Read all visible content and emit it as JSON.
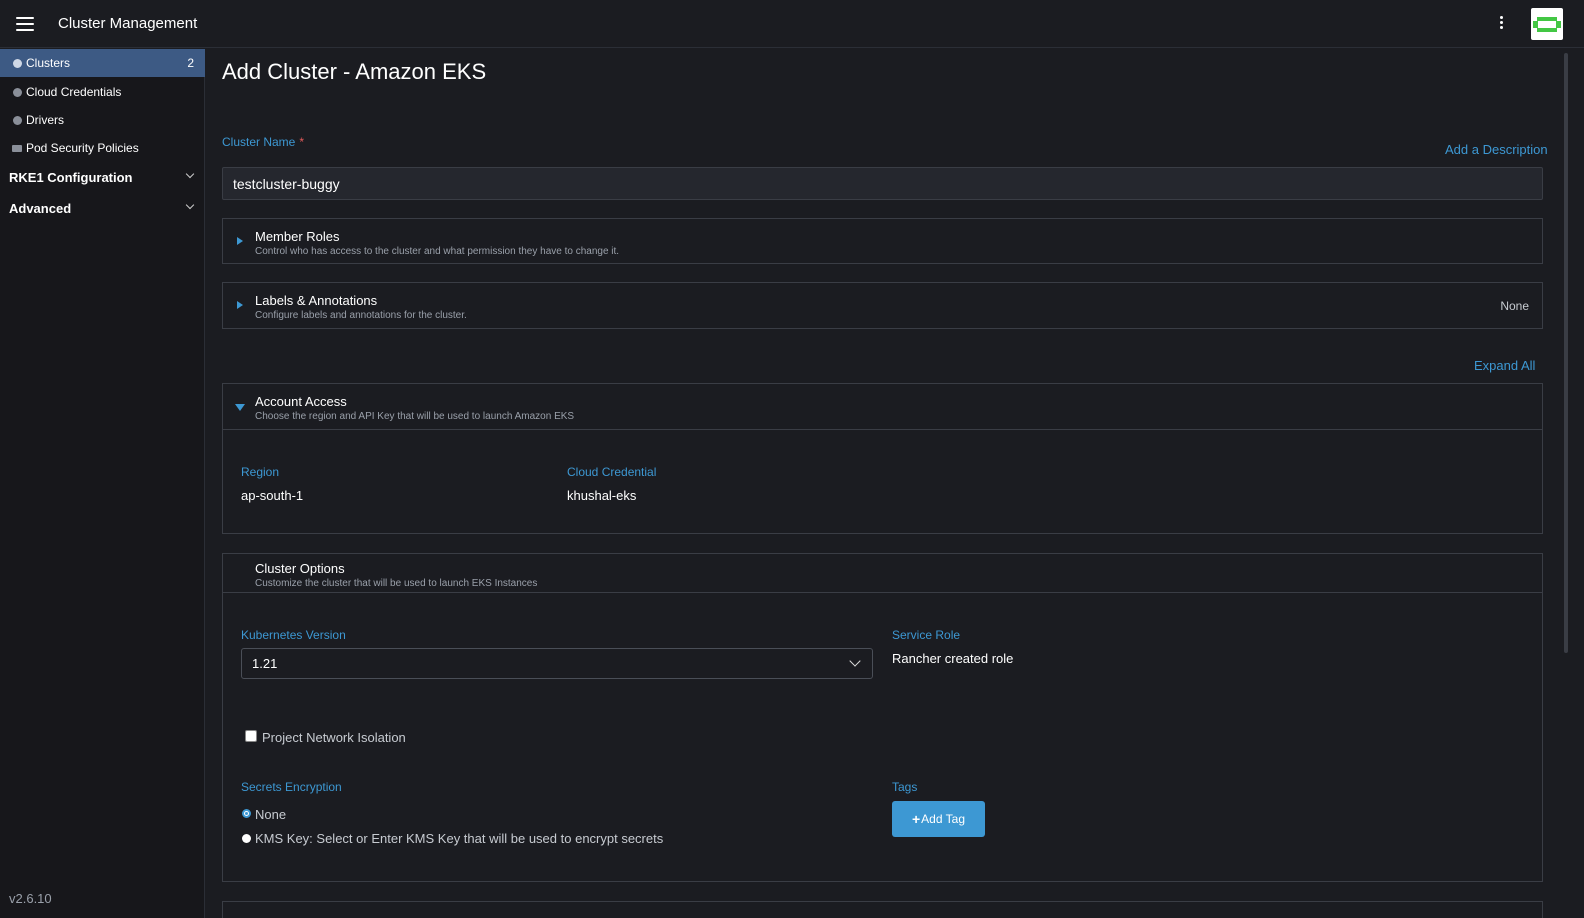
{
  "header": {
    "title": "Cluster Management"
  },
  "sidebar": {
    "items": [
      {
        "label": "Clusters",
        "count": "2"
      },
      {
        "label": "Cloud Credentials"
      },
      {
        "label": "Drivers"
      },
      {
        "label": "Pod Security Policies"
      }
    ],
    "groups": [
      {
        "label": "RKE1 Configuration"
      },
      {
        "label": "Advanced"
      }
    ],
    "version": "v2.6.10"
  },
  "main": {
    "title": "Add Cluster - Amazon EKS",
    "cluster_name_label": "Cluster Name",
    "required_mark": "*",
    "add_description": "Add a Description",
    "cluster_name_value": "testcluster-buggy",
    "expand_all": "Expand All",
    "member_roles": {
      "title": "Member Roles",
      "subtitle": "Control who has access to the cluster and what permission they have to change it."
    },
    "labels_annotations": {
      "title": "Labels & Annotations",
      "subtitle": "Configure labels and annotations for the cluster.",
      "note": "None"
    },
    "account_access": {
      "title": "Account Access",
      "subtitle": "Choose the region and API Key that will be used to launch Amazon EKS",
      "region_label": "Region",
      "region_value": "ap-south-1",
      "credential_label": "Cloud Credential",
      "credential_value": "khushal-eks"
    },
    "cluster_options": {
      "title": "Cluster Options",
      "subtitle": "Customize the cluster that will be used to launch EKS Instances",
      "k8s_label": "Kubernetes Version",
      "k8s_value": "1.21",
      "service_role_label": "Service Role",
      "service_role_value": "Rancher created role",
      "network_isolation": "Project Network Isolation",
      "secrets_label": "Secrets Encryption",
      "secrets_none": "None",
      "secrets_kms": "KMS Key: Select or Enter KMS Key that will be used to encrypt secrets",
      "tags_label": "Tags",
      "add_tag": "Add Tag"
    }
  },
  "colors": {
    "accent": "#3d98d3",
    "active_nav": "#3d5a84",
    "background": "#1b1c21"
  }
}
